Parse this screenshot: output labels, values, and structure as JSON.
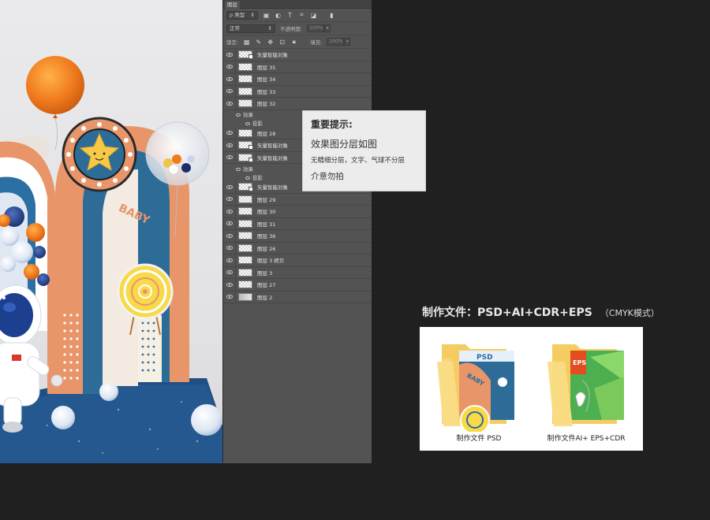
{
  "panel": {
    "tab_label": "图层",
    "filter_label": "ρ 类型",
    "blend_mode": "正常",
    "opacity_label": "不透明度:",
    "opacity_value": "100%",
    "lock_label": "锁定:",
    "fill_label": "填充:",
    "fill_value": "100%"
  },
  "layers": [
    {
      "name": "矢量智能对象",
      "thumb": "smart"
    },
    {
      "name": "图层 35",
      "thumb": "checker"
    },
    {
      "name": "图层 34",
      "thumb": "checker"
    },
    {
      "name": "图层 33",
      "thumb": "checker"
    },
    {
      "name": "图层 32",
      "thumb": "checker",
      "effects": [
        "效果",
        "投影"
      ]
    },
    {
      "name": "图层 28",
      "thumb": "checker"
    },
    {
      "name": "矢量智能对象",
      "thumb": "smart"
    },
    {
      "name": "矢量智能对象",
      "thumb": "smart",
      "effects": [
        "效果",
        "投影"
      ]
    },
    {
      "name": "矢量智能对象",
      "thumb": "smart"
    },
    {
      "name": "图层 29",
      "thumb": "checker"
    },
    {
      "name": "图层 30",
      "thumb": "checker"
    },
    {
      "name": "图层 31",
      "thumb": "checker"
    },
    {
      "name": "图层 36",
      "thumb": "checker"
    },
    {
      "name": "图层 26",
      "thumb": "checker"
    },
    {
      "name": "图层 3 拷贝",
      "thumb": "checker"
    },
    {
      "name": "图层 3",
      "thumb": "checker"
    },
    {
      "name": "图层 27",
      "thumb": "checker"
    },
    {
      "name": "图层 2",
      "thumb": "grey"
    }
  ],
  "tooltip": {
    "title": "重要提示:",
    "line1": "效果图分层如图",
    "line2": "无精细分层，文字、气球不分层",
    "line3": "介意勿拍"
  },
  "files": {
    "title": "制作文件：PSD+AI+CDR+EPS",
    "mode": "（CMYK模式）",
    "psd_label": "制作文件 PSD",
    "ai_label": "制作文件AI+ EPS+CDR"
  },
  "preview": {
    "arch_text": "BABY"
  },
  "colors": {
    "page_bg": "#202020",
    "panel_bg": "#535353",
    "arch_orange": "#e8956a",
    "arch_blue": "#2e6c98",
    "floor_blue": "#1f4f84",
    "balloon_orange": "#f07a1e"
  }
}
